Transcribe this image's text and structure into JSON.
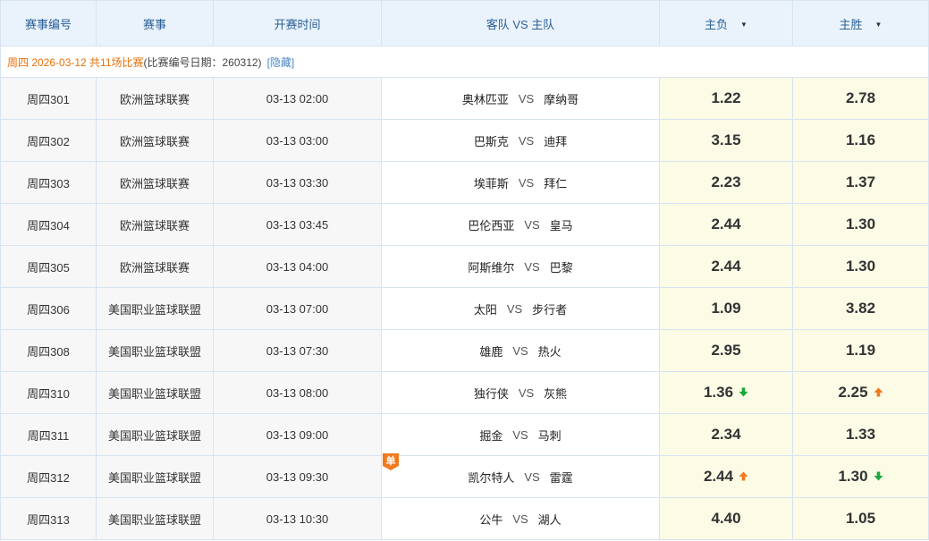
{
  "header": {
    "col_no": "赛事编号",
    "col_league": "赛事",
    "col_time": "开赛时间",
    "col_teams": "客队 VS 主队",
    "col_away_win": "主负",
    "col_home_win": "主胜",
    "sort_icon": "caret-down-icon"
  },
  "summary": {
    "date_text": "周四 2026-03-12 共11场比赛",
    "issue_text": "(比赛编号日期：260312)",
    "hide_label": "[隐藏]"
  },
  "vs_label": "VS",
  "badge_single": "单",
  "colors": {
    "header_bg": "#eaf3fc",
    "odds_bg": "#fbfbe6",
    "accent_orange": "#e8710a",
    "trend_up": "#f07a1e",
    "trend_down": "#1aa93c"
  },
  "matches": [
    {
      "no": "周四301",
      "league": "欧洲篮球联赛",
      "time": "03-13 02:00",
      "away": "奥林匹亚",
      "home": "摩纳哥",
      "away_win": "1.22",
      "home_win": "2.78",
      "away_trend": "",
      "home_trend": "",
      "single": false
    },
    {
      "no": "周四302",
      "league": "欧洲篮球联赛",
      "time": "03-13 03:00",
      "away": "巴斯克",
      "home": "迪拜",
      "away_win": "3.15",
      "home_win": "1.16",
      "away_trend": "",
      "home_trend": "",
      "single": false
    },
    {
      "no": "周四303",
      "league": "欧洲篮球联赛",
      "time": "03-13 03:30",
      "away": "埃菲斯",
      "home": "拜仁",
      "away_win": "2.23",
      "home_win": "1.37",
      "away_trend": "",
      "home_trend": "",
      "single": false
    },
    {
      "no": "周四304",
      "league": "欧洲篮球联赛",
      "time": "03-13 03:45",
      "away": "巴伦西亚",
      "home": "皇马",
      "away_win": "2.44",
      "home_win": "1.30",
      "away_trend": "",
      "home_trend": "",
      "single": false
    },
    {
      "no": "周四305",
      "league": "欧洲篮球联赛",
      "time": "03-13 04:00",
      "away": "阿斯维尔",
      "home": "巴黎",
      "away_win": "2.44",
      "home_win": "1.30",
      "away_trend": "",
      "home_trend": "",
      "single": false
    },
    {
      "no": "周四306",
      "league": "美国职业篮球联盟",
      "time": "03-13 07:00",
      "away": "太阳",
      "home": "步行者",
      "away_win": "1.09",
      "home_win": "3.82",
      "away_trend": "",
      "home_trend": "",
      "single": false
    },
    {
      "no": "周四308",
      "league": "美国职业篮球联盟",
      "time": "03-13 07:30",
      "away": "雄鹿",
      "home": "热火",
      "away_win": "2.95",
      "home_win": "1.19",
      "away_trend": "",
      "home_trend": "",
      "single": false
    },
    {
      "no": "周四310",
      "league": "美国职业篮球联盟",
      "time": "03-13 08:00",
      "away": "独行侠",
      "home": "灰熊",
      "away_win": "1.36",
      "home_win": "2.25",
      "away_trend": "down",
      "home_trend": "up",
      "single": false
    },
    {
      "no": "周四311",
      "league": "美国职业篮球联盟",
      "time": "03-13 09:00",
      "away": "掘金",
      "home": "马刺",
      "away_win": "2.34",
      "home_win": "1.33",
      "away_trend": "",
      "home_trend": "",
      "single": false
    },
    {
      "no": "周四312",
      "league": "美国职业篮球联盟",
      "time": "03-13 09:30",
      "away": "凯尔特人",
      "home": "雷霆",
      "away_win": "2.44",
      "home_win": "1.30",
      "away_trend": "up",
      "home_trend": "down",
      "single": true
    },
    {
      "no": "周四313",
      "league": "美国职业篮球联盟",
      "time": "03-13 10:30",
      "away": "公牛",
      "home": "湖人",
      "away_win": "4.40",
      "home_win": "1.05",
      "away_trend": "",
      "home_trend": "",
      "single": false
    }
  ]
}
